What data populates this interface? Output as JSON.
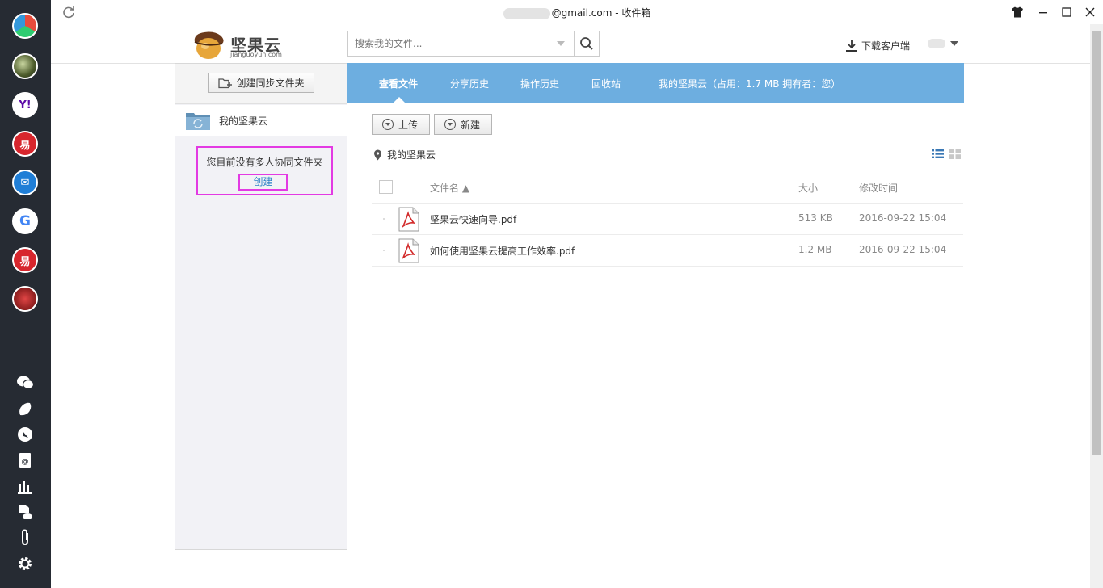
{
  "window": {
    "title_suffix": "@gmail.com - 收件箱"
  },
  "header": {
    "logo_text": "坚果云",
    "logo_sub": "jianguoyun.com",
    "search_placeholder": "搜索我的文件...",
    "download_label": "下载客户端"
  },
  "sidebar": {
    "create_sync_folder_label": "创建同步文件夹",
    "my_folder_label": "我的坚果云",
    "empty_message": "您目前没有多人协同文件夹",
    "create_link_label": "创建"
  },
  "tabs": [
    {
      "label": "查看文件",
      "active": true
    },
    {
      "label": "分享历史",
      "active": false
    },
    {
      "label": "操作历史",
      "active": false
    },
    {
      "label": "回收站",
      "active": false
    }
  ],
  "tab_info": "我的坚果云（占用：1.7 MB   拥有者：您）",
  "toolbar": {
    "upload_label": "上传",
    "new_label": "新建"
  },
  "breadcrumb": "我的坚果云",
  "table": {
    "columns": {
      "name": "文件名 ▲",
      "size": "大小",
      "modified": "修改时间"
    },
    "rows": [
      {
        "name": "坚果云快速向导.pdf",
        "size": "513 KB",
        "modified": "2016-09-22 15:04"
      },
      {
        "name": "如何使用坚果云提高工作效率.pdf",
        "size": "1.2 MB",
        "modified": "2016-09-22 15:04"
      }
    ]
  },
  "dock": {
    "apps": [
      "colorful-app-icon",
      "photo-avatar",
      "yahoo-mail-icon",
      "netease-mail-icon",
      "outlook-mail-icon",
      "gmail-google-icon",
      "netease-mail-icon-2",
      "photo-avatar-2"
    ],
    "tools": [
      "wechat-icon",
      "notes-icon",
      "compass-icon",
      "contacts-icon",
      "stats-icon",
      "cloud-file-icon",
      "attachment-icon",
      "settings-icon"
    ]
  },
  "colors": {
    "tab_bar": "#6daee0",
    "highlight_box": "#e33ae3",
    "link_blue": "#2f83c7",
    "dock_bg": "#262b33"
  }
}
